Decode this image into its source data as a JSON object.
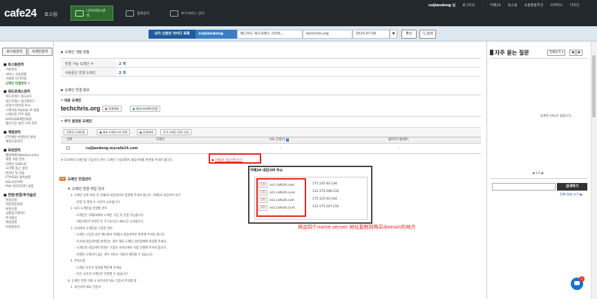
{
  "header": {
    "logo": "cafe24",
    "logo_sub": "호스팅",
    "nav": [
      {
        "label": "나의서비스관리",
        "active": true
      },
      {
        "label": "결제관리",
        "active": false
      },
      {
        "label": "부가서비스 관리",
        "active": false
      }
    ],
    "user": "cuijiandong 님",
    "util": [
      "로그아웃",
      "카페24",
      "호스팅",
      "쇼핑몰솔루션",
      "이커머스",
      "디자인"
    ]
  },
  "searchbar": {
    "label": "내가 신청한 아이디 목록",
    "user_id": "cuijiandong",
    "service": "매니지드 워드프레스 스타트...",
    "domain": "techchris.org",
    "date": "2023-07-09",
    "confirm_label": "확인",
    "search_label": "검색"
  },
  "sidebar": {
    "btn1": "호스팅관리",
    "btn2": "도메인관리",
    "sections": [
      {
        "title": "호스팅관리",
        "items": [
          "기본관리",
          "서비스 사용현황",
          "사용량 모니터링",
          "도메인 연결관리 >"
        ]
      },
      {
        "title": "워드프레스관리",
        "items": [
          "워드프레스 대시보드",
          "워드프레스 업그레이드",
          "운영/스테이징 복사",
          "스테이징 MySQL IP 설정",
          "스테이징 FTP 설정",
          "DATA/DB백업/복원",
          "플러그인 설치 구독 관리"
        ]
      },
      {
        "title": "계정관리",
        "items": [
          "FTP계정 비밀번호 변경",
          "계정도용차단"
        ]
      },
      {
        "title": "보안관리",
        "items": [
          "웹방화벽(WebSecurity)",
          "계정 서명 관리",
          "도메인 SHIELD",
          "국가별 접근 설정",
          "IP차단 및 허용",
          "FTP/SSH 접속설정",
          "SSL보안서버",
          "PHP 인터프리터 설정"
        ]
      },
      {
        "title": "연장/변경/추가옵션",
        "items": [
          "연장신청",
          "자동연장설정",
          "변경신청",
          "상품업그레이드",
          "추가옵션",
          "백업설정",
          "트래픽관리"
        ]
      }
    ],
    "active_item": "도메인 연결관리 >"
  },
  "main": {
    "section1_title": "도메인 개발 현황",
    "rows": [
      {
        "label": "연결 가능 도메인 수",
        "value": "2 개"
      },
      {
        "label": "사용중인 연결 도메인",
        "value": "2 개"
      }
    ],
    "section2_title": "도메인 연결 정보",
    "rep_domain_label": "대표 도메인",
    "rep_domain": "techchris.org",
    "rep_pills": [
      "연결해제",
      "메일서버(MX)전환"
    ],
    "extra_domain_label": "추가 설정된 도메인",
    "toolbar": [
      "선택된 도메인을",
      "대표 도메인으로 변경",
      "연결해제",
      "추가 도메인 등록 신청"
    ],
    "table_headers": [
      "선택",
      "도메인",
      "SSL 인증서",
      "클라우드플레어"
    ],
    "table_rows": [
      {
        "domain": "cuijiandong.mycafe24.com",
        "ssl": "-",
        "cf": "-"
      }
    ],
    "notice": "타사에서 도메인을 구입하신 경우, 도메인 구입처에서 네임서버를 변경해 주셔야 합니다.",
    "ns_link": "카페24 네임서버 보기",
    "section3_title": "도메인 연결관리",
    "guide_title": "A. 도메인 연결 작업 안내",
    "guide_items": [
      "1. 도메인 등록 완료 후 카페24 네임서버로 변경해 주셔야 합니다. 카페24 네임서버 보기",
      "- 연결 후 최대 수 시간이 소요됩니다.",
      "2. 보조 도메인을 연결할 경우",
      "- 도메인은 카페24에서 도메인 구입 후 연결 가능합니다.",
      "- 네임서버가 변경된 후 약 24시간~48시간 소요됩니다.",
      "3. 타사에서 도메인을 구입한 경우",
      "- 도메인 구입처 관리 메뉴에서 카페24 네임서버로 변경해 주셔야 합니다.",
      "- 타사에 네임서버를 변경하는 경우 해당 도메인 관리업체에 문의해 주세요.",
      "- 도메인의 네임서버 변경은 구입처 사이트에서 직접 진행해 주셔야 합니다.",
      "- 연결된 도메인이 없는 경우 서비스 이용이 제한될 수 있습니다.",
      "4. 주의사항",
      "- 도메인 소유자 정보를 확인해 주세요.",
      "- 타인 소유의 도메인은 연결할 수 없습니다.",
      "B. 도메인 연결 삭제 시 보안서버 SSL 인증서 주의할 점",
      "1. 보안서버 SSL 인증서"
    ]
  },
  "popup": {
    "title": "카페24 네임서버 주소",
    "nameservers": [
      {
        "tag": "1차",
        "host": "ns1.cafe24.com",
        "ip": "175.125.93.134"
      },
      {
        "tag": "2차",
        "host": "ns1.cafe24.co.kr",
        "ip": "112.175.246.232"
      },
      {
        "tag": "3차",
        "host": "ns2.cafe24.com",
        "ip": "175.125.93.144"
      },
      {
        "tag": "4차",
        "host": "ns2.cafe24.co.kr",
        "ip": "112.175.247.232"
      }
    ]
  },
  "annotation": "将这四个name server 地址复制到购买domain的地方",
  "right_panel": {
    "title": "자주 묻는 질문",
    "select": "전체보기",
    "empty": "등록된 FAQ가 없습니다.",
    "pager": "1/1",
    "search_btn": "검색하기",
    "more_link": "전체 FAQ 보기 ▶"
  },
  "chat_badge": "1"
}
